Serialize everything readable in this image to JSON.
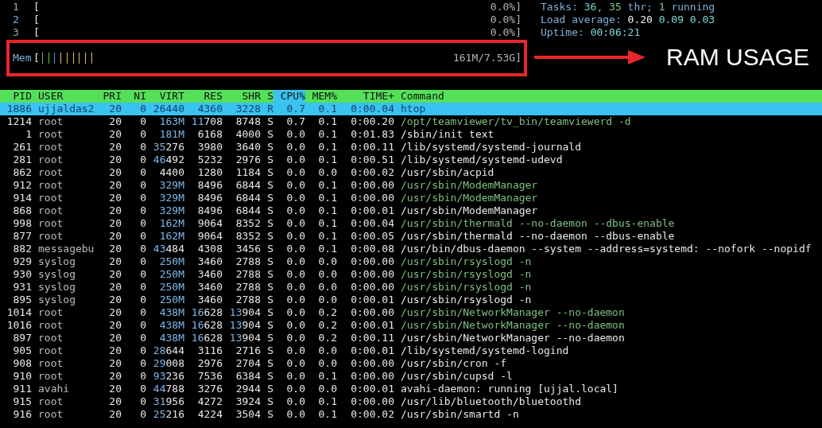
{
  "cpu_meters": [
    {
      "label": "1",
      "bracket": "[",
      "value": "0.0%]"
    },
    {
      "label": "2",
      "bracket": "[",
      "value": "0.0%]"
    },
    {
      "label": "3",
      "bracket": "[",
      "value": "0.0%]"
    }
  ],
  "memory": {
    "label": "Mem",
    "bracket": "[",
    "segments": [
      {
        "level": 0.026,
        "color": "#5fc35f"
      },
      {
        "level": 0.013,
        "color": "#5f8fd8"
      },
      {
        "level": 0.079,
        "color": "#d8c070"
      }
    ],
    "value": "161M/7.53G]"
  },
  "stats": [
    [
      {
        "text": "Tasks: ",
        "kind": "label"
      },
      {
        "text": "36",
        "kind": "value"
      },
      {
        "text": ", ",
        "kind": "label"
      },
      {
        "text": "35",
        "kind": "good"
      },
      {
        "text": " thr; ",
        "kind": "label"
      },
      {
        "text": "1",
        "kind": "good"
      },
      {
        "text": " running",
        "kind": "label"
      }
    ],
    [
      {
        "text": "Load average: ",
        "kind": "label"
      },
      {
        "text": "0.20 ",
        "kind": "bright"
      },
      {
        "text": "0.09 ",
        "kind": "value"
      },
      {
        "text": "0.03",
        "kind": "value"
      }
    ],
    [
      {
        "text": "Uptime: ",
        "kind": "label"
      },
      {
        "text": "00:06:21",
        "kind": "value"
      }
    ]
  ],
  "annotation": {
    "label": "RAM USAGE"
  },
  "table": {
    "columns": [
      {
        "label": "PID",
        "selected": false
      },
      {
        "label": "USER",
        "selected": false
      },
      {
        "label": "PRI",
        "selected": false
      },
      {
        "label": "NI",
        "selected": false
      },
      {
        "label": "VIRT",
        "selected": false
      },
      {
        "label": "RES",
        "selected": false
      },
      {
        "label": "SHR",
        "selected": false
      },
      {
        "label": "S",
        "selected": false
      },
      {
        "label": "CPU%",
        "selected": true
      },
      {
        "label": "MEM%",
        "selected": false
      },
      {
        "label": "TIME+",
        "selected": false
      },
      {
        "label": "Command",
        "selected": false
      }
    ],
    "rows": [
      {
        "selected": true,
        "thread": false,
        "cells": [
          "1886",
          "ujjaldas2",
          "20",
          "0",
          "26440",
          "4360",
          "3228",
          "R",
          "0.7",
          "0.1",
          "0:00.04",
          "htop"
        ]
      },
      {
        "selected": false,
        "thread": true,
        "cells": [
          "1214",
          "root",
          "20",
          "0",
          "163M",
          "11708",
          "8748",
          "S",
          "0.7",
          "0.1",
          "0:00.20",
          "/opt/teamviewer/tv_bin/teamviewerd -d"
        ]
      },
      {
        "selected": false,
        "thread": false,
        "cells": [
          "1",
          "root",
          "20",
          "0",
          "181M",
          "6168",
          "4000",
          "S",
          "0.0",
          "0.1",
          "0:01.83",
          "/sbin/init text"
        ]
      },
      {
        "selected": false,
        "thread": false,
        "cells": [
          "261",
          "root",
          "20",
          "0",
          "35276",
          "3980",
          "3640",
          "S",
          "0.0",
          "0.1",
          "0:00.11",
          "/lib/systemd/systemd-journald"
        ]
      },
      {
        "selected": false,
        "thread": false,
        "cells": [
          "281",
          "root",
          "20",
          "0",
          "46492",
          "5232",
          "2976",
          "S",
          "0.0",
          "0.1",
          "0:00.51",
          "/lib/systemd/systemd-udevd"
        ]
      },
      {
        "selected": false,
        "thread": false,
        "cells": [
          "862",
          "root",
          "20",
          "0",
          "4400",
          "1280",
          "1184",
          "S",
          "0.0",
          "0.0",
          "0:00.02",
          "/usr/sbin/acpid"
        ]
      },
      {
        "selected": false,
        "thread": true,
        "cells": [
          "912",
          "root",
          "20",
          "0",
          "329M",
          "8496",
          "6844",
          "S",
          "0.0",
          "0.1",
          "0:00.00",
          "/usr/sbin/ModemManager"
        ]
      },
      {
        "selected": false,
        "thread": true,
        "cells": [
          "914",
          "root",
          "20",
          "0",
          "329M",
          "8496",
          "6844",
          "S",
          "0.0",
          "0.1",
          "0:00.00",
          "/usr/sbin/ModemManager"
        ]
      },
      {
        "selected": false,
        "thread": false,
        "cells": [
          "868",
          "root",
          "20",
          "0",
          "329M",
          "8496",
          "6844",
          "S",
          "0.0",
          "0.1",
          "0:00.01",
          "/usr/sbin/ModemManager"
        ]
      },
      {
        "selected": false,
        "thread": true,
        "cells": [
          "998",
          "root",
          "20",
          "0",
          "162M",
          "9064",
          "8352",
          "S",
          "0.0",
          "0.1",
          "0:00.04",
          "/usr/sbin/thermald --no-daemon --dbus-enable"
        ]
      },
      {
        "selected": false,
        "thread": false,
        "cells": [
          "877",
          "root",
          "20",
          "0",
          "162M",
          "9064",
          "8352",
          "S",
          "0.0",
          "0.1",
          "0:00.05",
          "/usr/sbin/thermald --no-daemon --dbus-enable"
        ]
      },
      {
        "selected": false,
        "thread": false,
        "cells": [
          "882",
          "messagebu",
          "20",
          "0",
          "43484",
          "4308",
          "3456",
          "S",
          "0.0",
          "0.1",
          "0:00.08",
          "/usr/bin/dbus-daemon --system --address=systemd: --nofork --nopidf"
        ]
      },
      {
        "selected": false,
        "thread": true,
        "cells": [
          "929",
          "syslog",
          "20",
          "0",
          "250M",
          "3460",
          "2788",
          "S",
          "0.0",
          "0.0",
          "0:00.00",
          "/usr/sbin/rsyslogd -n"
        ]
      },
      {
        "selected": false,
        "thread": true,
        "cells": [
          "930",
          "syslog",
          "20",
          "0",
          "250M",
          "3460",
          "2788",
          "S",
          "0.0",
          "0.0",
          "0:00.00",
          "/usr/sbin/rsyslogd -n"
        ]
      },
      {
        "selected": false,
        "thread": true,
        "cells": [
          "931",
          "syslog",
          "20",
          "0",
          "250M",
          "3460",
          "2788",
          "S",
          "0.0",
          "0.0",
          "0:00.00",
          "/usr/sbin/rsyslogd -n"
        ]
      },
      {
        "selected": false,
        "thread": false,
        "cells": [
          "895",
          "syslog",
          "20",
          "0",
          "250M",
          "3460",
          "2788",
          "S",
          "0.0",
          "0.0",
          "0:00.01",
          "/usr/sbin/rsyslogd -n"
        ]
      },
      {
        "selected": false,
        "thread": true,
        "cells": [
          "1014",
          "root",
          "20",
          "0",
          "438M",
          "16628",
          "13904",
          "S",
          "0.0",
          "0.2",
          "0:00.00",
          "/usr/sbin/NetworkManager --no-daemon"
        ]
      },
      {
        "selected": false,
        "thread": true,
        "cells": [
          "1016",
          "root",
          "20",
          "0",
          "438M",
          "16628",
          "13904",
          "S",
          "0.0",
          "0.2",
          "0:00.01",
          "/usr/sbin/NetworkManager --no-daemon"
        ]
      },
      {
        "selected": false,
        "thread": false,
        "cells": [
          "897",
          "root",
          "20",
          "0",
          "438M",
          "16628",
          "13904",
          "S",
          "0.0",
          "0.2",
          "0:00.11",
          "/usr/sbin/NetworkManager --no-daemon"
        ]
      },
      {
        "selected": false,
        "thread": false,
        "cells": [
          "905",
          "root",
          "20",
          "0",
          "28644",
          "3116",
          "2716",
          "S",
          "0.0",
          "0.0",
          "0:00.01",
          "/lib/systemd/systemd-logind"
        ]
      },
      {
        "selected": false,
        "thread": false,
        "cells": [
          "908",
          "root",
          "20",
          "0",
          "29008",
          "2976",
          "2704",
          "S",
          "0.0",
          "0.0",
          "0:00.00",
          "/usr/sbin/cron -f"
        ]
      },
      {
        "selected": false,
        "thread": false,
        "cells": [
          "910",
          "root",
          "20",
          "0",
          "93236",
          "7536",
          "6384",
          "S",
          "0.0",
          "0.1",
          "0:00.00",
          "/usr/sbin/cupsd -l"
        ]
      },
      {
        "selected": false,
        "thread": false,
        "cells": [
          "911",
          "avahi",
          "20",
          "0",
          "44788",
          "3276",
          "2944",
          "S",
          "0.0",
          "0.0",
          "0:00.01",
          "avahi-daemon: running [ujjal.local]"
        ]
      },
      {
        "selected": false,
        "thread": false,
        "cells": [
          "915",
          "root",
          "20",
          "0",
          "31956",
          "4272",
          "3924",
          "S",
          "0.0",
          "0.1",
          "0:00.00",
          "/usr/lib/bluetooth/bluetoothd"
        ]
      },
      {
        "selected": false,
        "thread": false,
        "cells": [
          "916",
          "root",
          "20",
          "0",
          "25216",
          "4224",
          "3504",
          "S",
          "0.0",
          "0.1",
          "0:00.02",
          "/usr/sbin/smartd -n"
        ]
      }
    ]
  }
}
